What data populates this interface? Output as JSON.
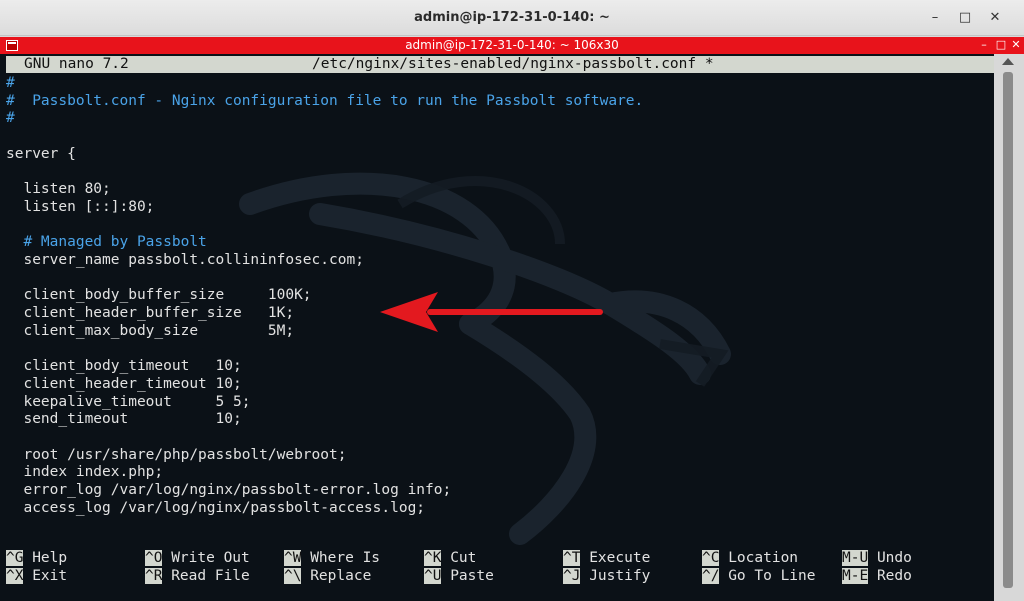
{
  "window": {
    "title": "admin@ip-172-31-0-140: ~",
    "minimize_glyph": "–",
    "maximize_glyph": "□",
    "close_glyph": "✕"
  },
  "terminal_window": {
    "title": "admin@ip-172-31-0-140: ~ 106x30",
    "accent_color": "#e8131b"
  },
  "nano": {
    "app_name": "GNU nano 7.2",
    "file_path": "/etc/nginx/sites-enabled/nginx-passbolt.conf *"
  },
  "lines": [
    {
      "text": "#",
      "kind": "comment"
    },
    {
      "text": "#  Passbolt.conf - Nginx configuration file to run the Passbolt software.",
      "kind": "comment"
    },
    {
      "text": "#",
      "kind": "comment"
    },
    {
      "text": "",
      "kind": "code"
    },
    {
      "text": "server {",
      "kind": "code"
    },
    {
      "text": "",
      "kind": "code"
    },
    {
      "text": "  listen 80;",
      "kind": "code"
    },
    {
      "text": "  listen [::]:80;",
      "kind": "code"
    },
    {
      "text": "",
      "kind": "code"
    },
    {
      "text": "  # Managed by Passbolt",
      "kind": "comment"
    },
    {
      "text": "  server_name passbolt.collininfosec.com;",
      "kind": "code"
    },
    {
      "text": "",
      "kind": "code"
    },
    {
      "text": "  client_body_buffer_size     100K;",
      "kind": "code"
    },
    {
      "text": "  client_header_buffer_size   1K;",
      "kind": "code"
    },
    {
      "text": "  client_max_body_size        5M;",
      "kind": "code"
    },
    {
      "text": "",
      "kind": "code"
    },
    {
      "text": "  client_body_timeout   10;",
      "kind": "code"
    },
    {
      "text": "  client_header_timeout 10;",
      "kind": "code"
    },
    {
      "text": "  keepalive_timeout     5 5;",
      "kind": "code"
    },
    {
      "text": "  send_timeout          10;",
      "kind": "code"
    },
    {
      "text": "",
      "kind": "code"
    },
    {
      "text": "  root /usr/share/php/passbolt/webroot;",
      "kind": "code"
    },
    {
      "text": "  index index.php;",
      "kind": "code"
    },
    {
      "text": "  error_log /var/log/nginx/passbolt-error.log info;",
      "kind": "code"
    },
    {
      "text": "  access_log /var/log/nginx/passbolt-access.log;",
      "kind": "code"
    }
  ],
  "shortcuts": [
    {
      "key": "^G",
      "label": "Help"
    },
    {
      "key": "^O",
      "label": "Write Out"
    },
    {
      "key": "^W",
      "label": "Where Is"
    },
    {
      "key": "^K",
      "label": "Cut"
    },
    {
      "key": "^T",
      "label": "Execute"
    },
    {
      "key": "^C",
      "label": "Location"
    },
    {
      "key": "M-U",
      "label": "Undo"
    },
    {
      "key": "^X",
      "label": "Exit"
    },
    {
      "key": "^R",
      "label": "Read File"
    },
    {
      "key": "^\\",
      "label": "Replace"
    },
    {
      "key": "^U",
      "label": "Paste"
    },
    {
      "key": "^J",
      "label": "Justify"
    },
    {
      "key": "^/",
      "label": "Go To Line"
    },
    {
      "key": "M-E",
      "label": "Redo"
    }
  ],
  "annotation": {
    "icon": "red-arrow-icon",
    "color": "#e3191f"
  }
}
